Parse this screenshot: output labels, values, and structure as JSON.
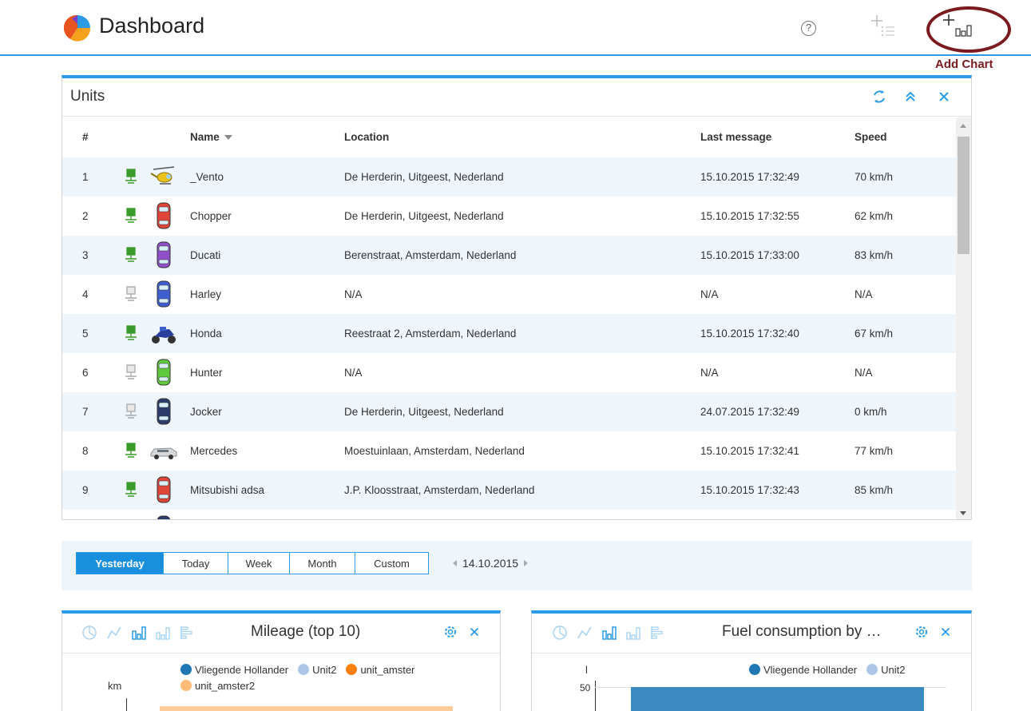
{
  "app": {
    "title": "Dashboard"
  },
  "toolbar": {
    "help_glyph": "?",
    "add_chart_caption": "Add Chart"
  },
  "colors": {
    "accent": "#2b9be6",
    "highlight": "#7b1a1f",
    "row_alt": "#eef6fc"
  },
  "units": {
    "title": "Units",
    "columns": {
      "num": "#",
      "name": "Name",
      "location": "Location",
      "last_message": "Last message",
      "speed": "Speed"
    },
    "rows": [
      {
        "num": "1",
        "name": "_Vento",
        "location": "De Herderin, Uitgeest, Nederland",
        "last_message": "15.10.2015 17:32:49",
        "speed": "70 km/h",
        "online": true,
        "icon": "helicopter-icon"
      },
      {
        "num": "2",
        "name": "Chopper",
        "location": "De Herderin, Uitgeest, Nederland",
        "last_message": "15.10.2015 17:32:55",
        "speed": "62 km/h",
        "online": true,
        "icon": "car-red-icon"
      },
      {
        "num": "3",
        "name": "Ducati",
        "location": "Berenstraat, Amsterdam, Nederland",
        "last_message": "15.10.2015 17:33:00",
        "speed": "83 km/h",
        "online": true,
        "icon": "car-purple-icon"
      },
      {
        "num": "4",
        "name": "Harley",
        "location": "N/A",
        "last_message": "N/A",
        "speed": "N/A",
        "online": false,
        "icon": "car-blue-icon"
      },
      {
        "num": "5",
        "name": "Honda",
        "location": "Reestraat 2, Amsterdam, Nederland",
        "last_message": "15.10.2015 17:32:40",
        "speed": "67 km/h",
        "online": true,
        "icon": "motorcycle-icon"
      },
      {
        "num": "6",
        "name": "Hunter",
        "location": "N/A",
        "last_message": "N/A",
        "speed": "N/A",
        "online": false,
        "icon": "car-green-icon"
      },
      {
        "num": "7",
        "name": "Jocker",
        "location": "De Herderin, Uitgeest, Nederland",
        "last_message": "24.07.2015 17:32:49",
        "speed": "0 km/h",
        "online": false,
        "icon": "car-navy-icon"
      },
      {
        "num": "8",
        "name": "Mercedes",
        "location": "Moestuinlaan, Amsterdam, Nederland",
        "last_message": "15.10.2015 17:32:41",
        "speed": "77 km/h",
        "online": true,
        "icon": "limousine-icon"
      },
      {
        "num": "9",
        "name": "Mitsubishi adsa",
        "location": "J.P. Kloosstraat, Amsterdam, Nederland",
        "last_message": "15.10.2015 17:32:43",
        "speed": "85 km/h",
        "online": true,
        "icon": "car-red-icon"
      }
    ]
  },
  "range": {
    "buttons": [
      "Yesterday",
      "Today",
      "Week",
      "Month",
      "Custom"
    ],
    "active": "Yesterday",
    "date": "14.10.2015"
  },
  "charts": {
    "mileage": {
      "title": "Mileage (top 10)",
      "unit": "km",
      "legend": [
        {
          "name": "Vliegende Hollander",
          "color": "#1f77b4"
        },
        {
          "name": "Unit2",
          "color": "#aec7e8"
        },
        {
          "name": "unit_amster",
          "color": "#ff7f0e"
        },
        {
          "name": "unit_amster2",
          "color": "#ffbb78"
        }
      ]
    },
    "fuel": {
      "title": "Fuel consumption by …",
      "unit": "l",
      "tick": "50",
      "legend": [
        {
          "name": "Vliegende Hollander",
          "color": "#1f77b4"
        },
        {
          "name": "Unit2",
          "color": "#aec7e8"
        }
      ]
    }
  }
}
